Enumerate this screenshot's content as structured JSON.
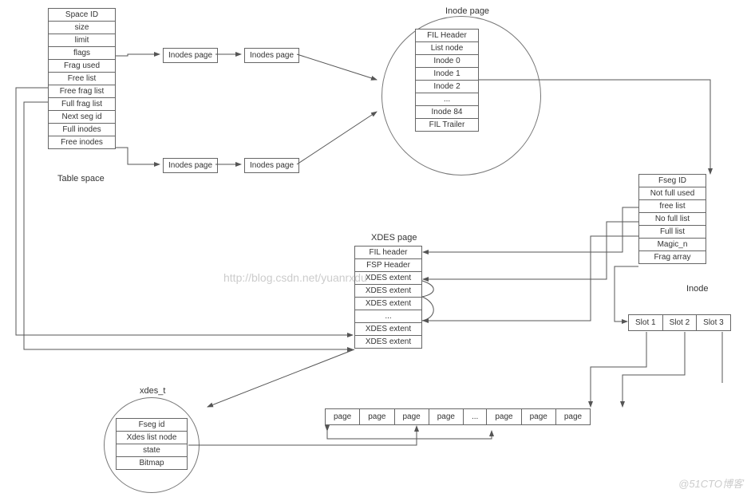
{
  "tablespace": {
    "label": "Table space",
    "rows": [
      "Space ID",
      "size",
      "limit",
      "flags",
      "Frag used",
      "Free list",
      "Free frag list",
      "Full frag list",
      "Next seg id",
      "Full inodes",
      "Free inodes"
    ]
  },
  "inodepages": {
    "label": "Inodes page"
  },
  "inodepage": {
    "title": "Inode page",
    "rows": [
      "FIL Header",
      "List node",
      "Inode 0",
      "Inode 1",
      "Inode 2",
      "...",
      "Inode 84",
      "FIL Trailer"
    ]
  },
  "inode": {
    "title": "Inode",
    "rows": [
      "Fseg ID",
      "Not full used",
      "free list",
      "No full list",
      "Full list",
      "Magic_n",
      "Frag array"
    ]
  },
  "xdespage": {
    "title": "XDES page",
    "rows": [
      "FIL header",
      "FSP Header",
      "XDES extent",
      "XDES extent",
      "XDES extent",
      "...",
      "XDES extent",
      "XDES extent"
    ]
  },
  "xdes_t": {
    "title": "xdes_t",
    "rows": [
      "Fseg id",
      "Xdes  list node",
      "state",
      "Bitmap"
    ]
  },
  "slots": [
    "Slot 1",
    "Slot 2",
    "Slot 3"
  ],
  "pages": [
    "page",
    "page",
    "page",
    "page",
    "...",
    "page",
    "page",
    "page"
  ],
  "watermark_blog": "http://blog.csdn.net/yuanrxdu",
  "watermark_51cto": "@51CTO博客"
}
